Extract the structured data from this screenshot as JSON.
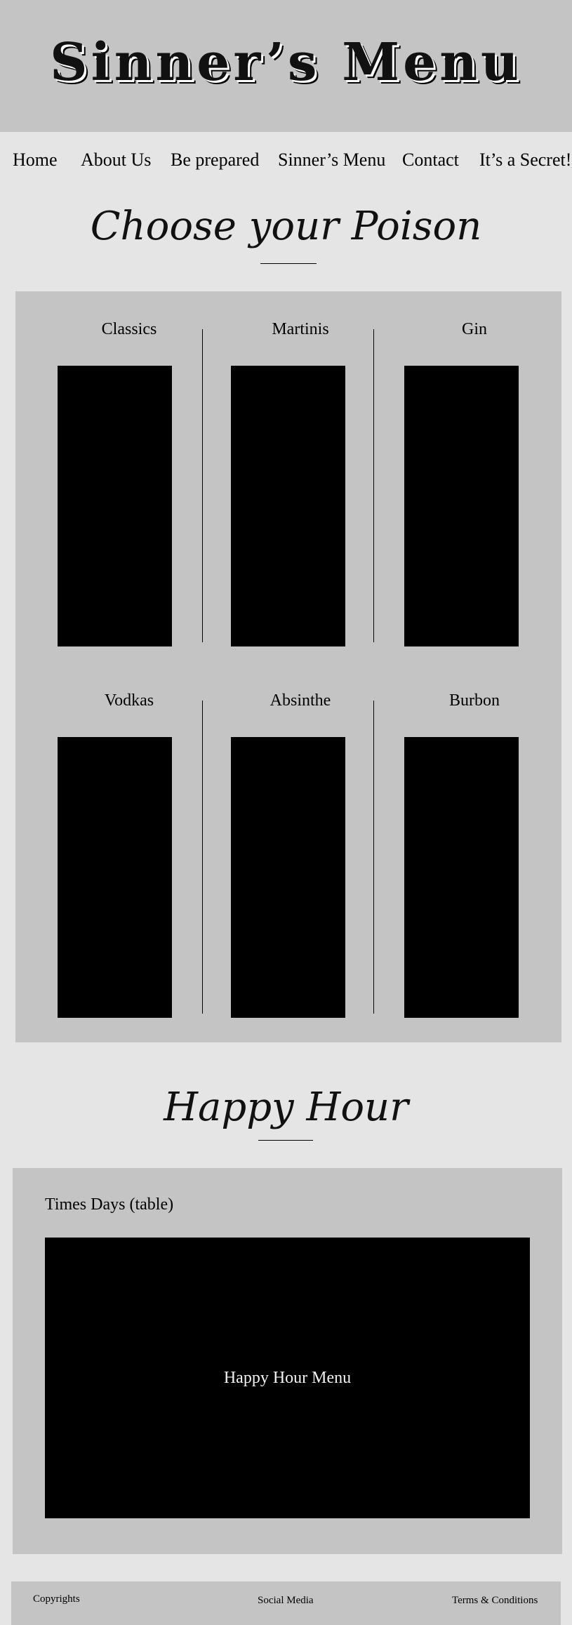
{
  "header": {
    "title": "Sinner’s Menu"
  },
  "nav": {
    "items": [
      {
        "label": "Home"
      },
      {
        "label": "About Us"
      },
      {
        "label": "Be prepared"
      },
      {
        "label": "Sinner’s Menu"
      },
      {
        "label": "Contact"
      },
      {
        "label": "It’s a Secret!"
      }
    ]
  },
  "menu_section": {
    "title": "Choose your Poison",
    "categories": [
      {
        "label": "Classics"
      },
      {
        "label": "Martinis"
      },
      {
        "label": "Gin"
      },
      {
        "label": "Vodkas"
      },
      {
        "label": "Absinthe"
      },
      {
        "label": "Burbon"
      }
    ]
  },
  "happy_hour": {
    "title": "Happy Hour",
    "caption": "Times Days (table)",
    "box_label": "Happy Hour Menu"
  },
  "footer": {
    "copyrights": "Copyrights",
    "social_media": "Social Media",
    "terms": "Terms & Conditions"
  },
  "colors": {
    "page_background": "#e5e5e5",
    "panel_background": "#c4c4c4",
    "placeholder_image": "#000000",
    "text": "#000000"
  }
}
